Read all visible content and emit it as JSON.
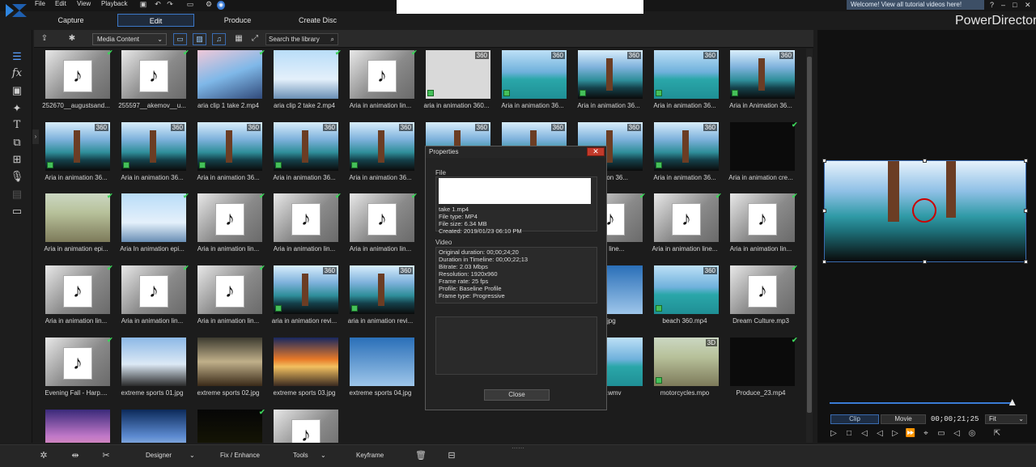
{
  "menu": {
    "items": [
      "File",
      "Edit",
      "View",
      "Playback"
    ]
  },
  "tabs": [
    {
      "label": "Capture"
    },
    {
      "label": "Edit"
    },
    {
      "label": "Produce"
    },
    {
      "label": "Create Disc"
    }
  ],
  "app_name": "PowerDirector",
  "welcome": "Welcome! View all tutorial videos here!",
  "library": {
    "dropdown": "Media Content",
    "search_placeholder": "Search the library"
  },
  "tiles": [
    {
      "label": "252670__augustsand...",
      "kind": "audio",
      "check": true
    },
    {
      "label": "255597__akemov__u...",
      "kind": "audio",
      "check": true
    },
    {
      "label": "aria clip 1 take 2.mp4",
      "kind": "anime",
      "check": true
    },
    {
      "label": "aria clip 2 take 2.mp4",
      "kind": "weather",
      "check": true
    },
    {
      "label": "Aria in animation lin...",
      "kind": "audio",
      "check": true
    },
    {
      "label": "aria in animation 360...",
      "kind": "ghost",
      "badge": "360"
    },
    {
      "label": "Aria in animation 36...",
      "kind": "sea",
      "badge": "360"
    },
    {
      "label": "Aria in animation 36...",
      "kind": "pano",
      "badge": "360"
    },
    {
      "label": "Aria in animation 36...",
      "kind": "sea",
      "badge": "360"
    },
    {
      "label": "Aria in Animation 36...",
      "kind": "pano",
      "badge": "360"
    },
    {
      "label": "Aria in animation 36...",
      "kind": "pano",
      "badge": "360"
    },
    {
      "label": "Aria in animation 36...",
      "kind": "pano",
      "badge": "360"
    },
    {
      "label": "Aria in animation 36...",
      "kind": "pano",
      "badge": "360"
    },
    {
      "label": "Aria in animation 36...",
      "kind": "pano",
      "badge": "360"
    },
    {
      "label": "Aria in animation 36...",
      "kind": "pano",
      "badge": "360"
    },
    {
      "label": "",
      "kind": "pano",
      "badge": "360"
    },
    {
      "label": "",
      "kind": "pano",
      "badge": "360"
    },
    {
      "label": "nimation 36...",
      "kind": "pano",
      "badge": "360"
    },
    {
      "label": "Aria in animation 36...",
      "kind": "pano",
      "badge": "360"
    },
    {
      "label": "Aria in animation cre...",
      "kind": "dark",
      "check": true
    },
    {
      "label": "Aria in animation epi...",
      "kind": "street",
      "check": true
    },
    {
      "label": "Aria In animation epi...",
      "kind": "weather",
      "check": true
    },
    {
      "label": "Aria in animation lin...",
      "kind": "audio",
      "check": true
    },
    {
      "label": "Aria in animation lin...",
      "kind": "audio",
      "check": true
    },
    {
      "label": "Aria in animation lin...",
      "kind": "audio",
      "check": true
    },
    {
      "label": "",
      "kind": "audio"
    },
    {
      "label": "",
      "kind": "audio"
    },
    {
      "label": "ation line...",
      "kind": "audio",
      "check": true
    },
    {
      "label": "Aria in animation line...",
      "kind": "audio",
      "check": true
    },
    {
      "label": "Aria in animation lin...",
      "kind": "audio",
      "check": true
    },
    {
      "label": "Aria in animation lin...",
      "kind": "audio",
      "check": true
    },
    {
      "label": "Aria in animation lin...",
      "kind": "audio",
      "check": true
    },
    {
      "label": "Aria in animation lin...",
      "kind": "audio",
      "check": true
    },
    {
      "label": "aria in animation revi...",
      "kind": "pano",
      "badge": "360"
    },
    {
      "label": "aria in animation revi...",
      "kind": "pano",
      "badge": "360"
    },
    {
      "label": "",
      "kind": "pano"
    },
    {
      "label": "",
      "kind": "pano"
    },
    {
      "label": "n.jpg",
      "kind": "sport4"
    },
    {
      "label": "beach 360.mp4",
      "kind": "sea",
      "badge": "360"
    },
    {
      "label": "Dream Culture.mp3",
      "kind": "audio",
      "check": true
    },
    {
      "label": "Evening Fall - Harp....",
      "kind": "audio",
      "check": true
    },
    {
      "label": "extreme sports 01.jpg",
      "kind": "sport1"
    },
    {
      "label": "extreme sports 02.jpg",
      "kind": "sport2"
    },
    {
      "label": "extreme sports 03.jpg",
      "kind": "sport3"
    },
    {
      "label": "extreme sports 04.jpg",
      "kind": "sport4"
    },
    {
      "label": "",
      "kind": "sea"
    },
    {
      "label": "",
      "kind": "sea"
    },
    {
      "label": "ling.wmv",
      "kind": "sea"
    },
    {
      "label": "motorcycles.mpo",
      "kind": "street",
      "badge": "3D"
    },
    {
      "label": "Produce_23.mp4",
      "kind": "dark",
      "check": true
    },
    {
      "label": "",
      "kind": "sunset"
    },
    {
      "label": "",
      "kind": "sky2"
    },
    {
      "label": "",
      "kind": "movie",
      "check": true
    },
    {
      "label": "",
      "kind": "audio"
    }
  ],
  "properties": {
    "title": "Properties",
    "close_x": "✕",
    "file_section": "File",
    "file_lines": [
      "take 1.mp4",
      "File type: MP4",
      "File size: 6.34 MB",
      "Created: 2019/01/23 06:10 PM"
    ],
    "video_section": "Video",
    "video_lines": [
      "Original duration: 00;00;24;20",
      "Duration in Timeline: 00;00;22;13",
      "Bitrate: 2.03 Mbps",
      "Resolution: 1920x960",
      "Frame rate: 25 fps",
      "Profile: Baseline Profile",
      "Frame type: Progressive"
    ],
    "close_button": "Close"
  },
  "preview": {
    "clip": "Clip",
    "movie": "Movie",
    "timecode": "00;00;21;25",
    "fit": "Fit",
    "position": 0.99
  },
  "bottom": {
    "designer": "Designer",
    "fix": "Fix / Enhance",
    "tools": "Tools",
    "keyframe": "Keyframe"
  }
}
